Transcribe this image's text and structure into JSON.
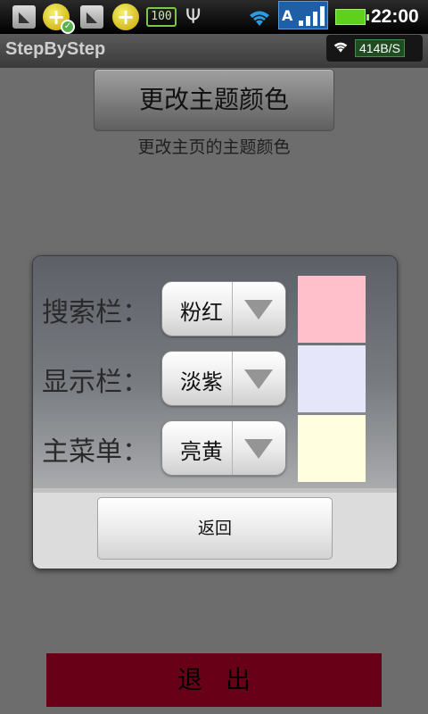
{
  "status_bar": {
    "battery_small": "100",
    "signal_label": "A",
    "time": "22:00",
    "icons": [
      "notification-icon",
      "download-complete-icon",
      "notification-icon",
      "download-icon",
      "battery-100-icon",
      "usb-icon",
      "wifi-icon",
      "signal-icon",
      "battery-icon"
    ]
  },
  "title_bar": {
    "title": "StepByStep",
    "net_speed": "414B/S"
  },
  "main": {
    "theme_button_label": "更改主题颜色",
    "theme_description": "更改主页的主题颜色"
  },
  "dialog": {
    "rows": [
      {
        "label": "搜索栏：",
        "selected": "粉红",
        "swatch_color": "#ffc0cb"
      },
      {
        "label": "显示栏：",
        "selected": "淡紫",
        "swatch_color": "#e6e6fa"
      },
      {
        "label": "主菜单：",
        "selected": "亮黄",
        "swatch_color": "#ffffe0"
      }
    ],
    "back_label": "返回"
  },
  "exit_label": "退出",
  "colors": {
    "exit_button": "#680017",
    "background": "#6d6d6d"
  }
}
